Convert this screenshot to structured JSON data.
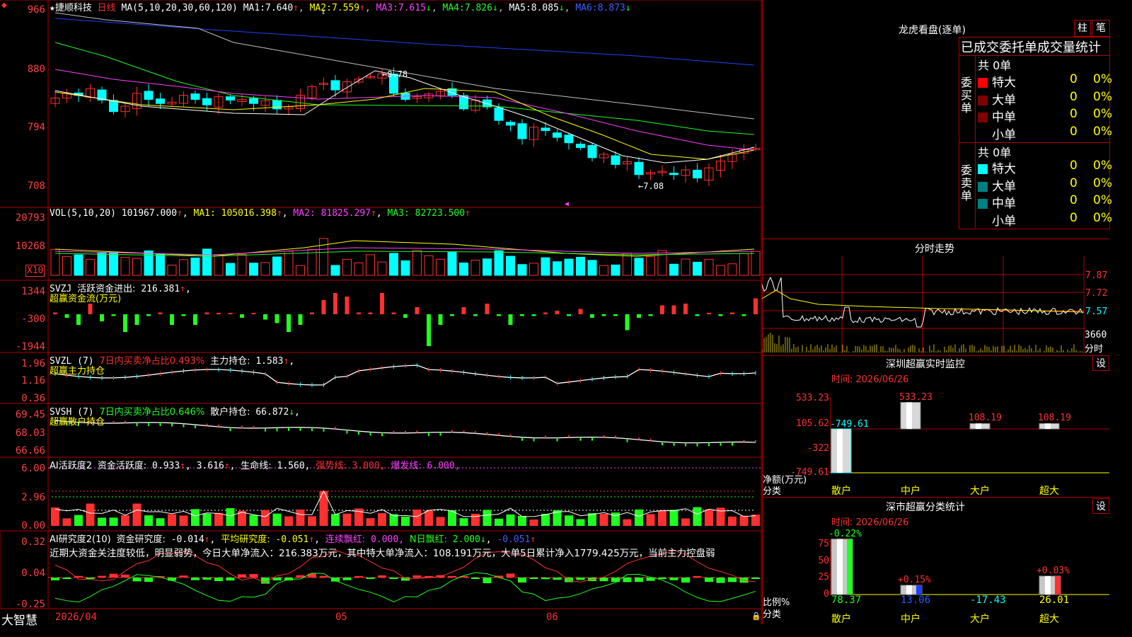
{
  "colors": {
    "up": "#ff3030",
    "down": "#00ffff",
    "frame": "#b00000",
    "ma1": "#ffffff",
    "ma2": "#ffff00",
    "ma3": "#ff40ff",
    "ma4": "#20ff20",
    "ma5": "#c0c0c0",
    "ma6": "#2040ff"
  },
  "header": {
    "star": "★",
    "stock": "捷顺科技",
    "period": "日线",
    "ma_label": "MA(5,10,20,30,60,120)",
    "ma": [
      {
        "k": "MA1:",
        "v": "7.640",
        "a": "↑"
      },
      {
        "k": "MA2:",
        "v": "7.559",
        "a": "↑"
      },
      {
        "k": "MA3:",
        "v": "7.615",
        "a": "↓"
      },
      {
        "k": "MA4:",
        "v": "7.826",
        "a": "↓"
      },
      {
        "k": "MA5:",
        "v": "8.085",
        "a": "↓"
      },
      {
        "k": "MA6:",
        "v": "8.873",
        "a": "↓"
      }
    ]
  },
  "price_axis": [
    "966",
    "880",
    "794",
    "708"
  ],
  "price_marks": {
    "high": "8.78",
    "low": "7.08"
  },
  "vol": {
    "label": "VOL(5,10,20)",
    "val": "101967.000",
    "a": "↑",
    "ma1": "105016.398",
    "ma2": "81825.297",
    "ma3": "82723.500",
    "axis": [
      "20793",
      "10268"
    ],
    "unit": "X10"
  },
  "svzj": {
    "label": "SVZJ",
    "t1": "活跃资金进出:",
    "v1": "216.381",
    "a": "↑",
    "sub": "超赢资金流(万元)",
    "axis": [
      "1344",
      "-300",
      "-1944"
    ]
  },
  "svzl": {
    "label": "SVZL (7)",
    "t1": "7日内买卖净占比0.493%",
    "t2": "主力持仓:",
    "v2": "1.583",
    "a": "↑",
    "sub": "超赢主力持仓",
    "axis": [
      "1.96",
      "1.16",
      "0.36"
    ]
  },
  "svsh": {
    "label": "SVSH (7)",
    "t1": "7日内买卖净占比0.646%",
    "t2": "散户持仓:",
    "v2": "66.872",
    "a": "↓",
    "sub": "超赢散户持仓",
    "axis": [
      "69.45",
      "68.03",
      "66.66"
    ]
  },
  "ai1": {
    "label": "AI活跃度2",
    "t1": "资金活跃度:",
    "v1": "0.933",
    "a1": "↑",
    "v2": "3.616",
    "t3": "生命线:",
    "v3": "1.560",
    "t4": "强势线:",
    "v4": "3.000",
    "t5": "爆发线:",
    "v5": "6.000",
    "axis": [
      "6.00",
      "2.96",
      "0.00"
    ]
  },
  "ai2": {
    "label": "AI研究度2(10)",
    "t1": "资金研究度:",
    "v1": "-0.014",
    "t2": "平均研究度:",
    "v2": "-0.051",
    "t3": "连续飘红:",
    "v3": "0.000",
    "t4": "N日飘红:",
    "v4": "2.000",
    "v5": "-0.051",
    "axis": [
      "0.32",
      "0.04",
      "-0.25"
    ],
    "comment": "近期大资金关注度较低，明显弱势，今日大单净流入：216.383万元，其中特大单净流入：108.191万元，大单5日累计净入1779.425万元，当前主力控盘弱"
  },
  "xaxis": {
    "d1": "2026/04",
    "d2": "05",
    "d3": "06"
  },
  "brand": "大智慧",
  "lhb": {
    "title": "龙虎看盘(逐单)",
    "btn1": "柱",
    "btn2": "笔",
    "subtitle": "已成交委托单成交量统计",
    "buy_side": "委买单",
    "sell_side": "委卖单",
    "total": "共 0单",
    "buy": [
      {
        "name": "特大",
        "v": "0",
        "p": "0%"
      },
      {
        "name": "大单",
        "v": "0",
        "p": "0%"
      },
      {
        "name": "中单",
        "v": "0",
        "p": "0%"
      },
      {
        "name": "小单",
        "v": "0",
        "p": "0%"
      }
    ],
    "sell": [
      {
        "name": "特大",
        "v": "0",
        "p": "0%"
      },
      {
        "name": "大单",
        "v": "0",
        "p": "0%"
      },
      {
        "name": "中单",
        "v": "0",
        "p": "0%"
      },
      {
        "name": "小单",
        "v": "0",
        "p": "0%"
      }
    ]
  },
  "fenshi": {
    "title": "分时走势",
    "axis": [
      "7.87",
      "7.72",
      "7.57",
      "3660"
    ],
    "unit": "分时"
  },
  "mon": {
    "title": "深圳超赢实时监控",
    "btn": "设",
    "time": "时间: 2026/06/26",
    "axis": [
      "533.23",
      "105.62",
      "-322",
      "-749.61"
    ],
    "ylabel": "净额(万元)",
    "xlabel": "分类",
    "cats": [
      "散户",
      "中户",
      "大户",
      "超大"
    ],
    "labels": [
      "-749.61",
      "533.23",
      "108.19",
      "108.19"
    ],
    "values": [
      -749.61,
      533.23,
      108.19,
      108.19
    ]
  },
  "cls": {
    "title": "深市超赢分类统计",
    "btn": "设",
    "time": "时间: 2026/06/26",
    "axis": [
      "75",
      "50",
      "25",
      "0"
    ],
    "ylabel": "比例%",
    "xlabel": "分类",
    "cats": [
      "散户",
      "中户",
      "大户",
      "超大"
    ],
    "top": [
      "-0.22%",
      "+0.15%",
      "",
      "+0.03%"
    ],
    "bottom": [
      "78.37",
      "13.06",
      "-17.43",
      "26.01"
    ],
    "values": [
      78.37,
      13.06,
      0,
      26.01
    ]
  }
}
